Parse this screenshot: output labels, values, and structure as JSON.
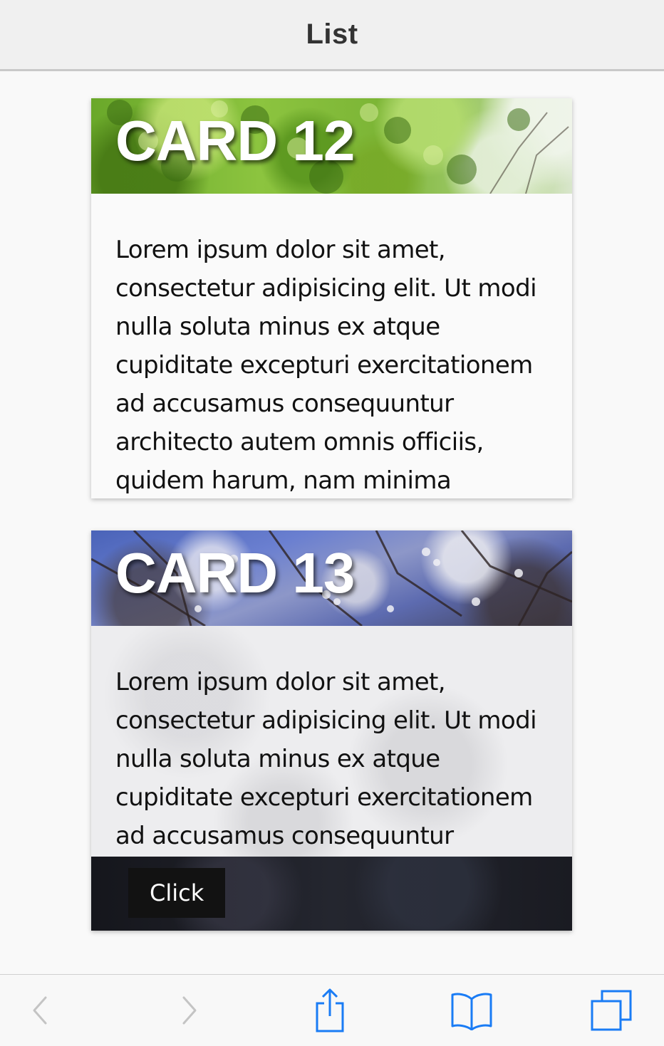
{
  "nav": {
    "title": "List"
  },
  "cards": [
    {
      "title": "CARD 12",
      "body": "Lorem ipsum dolor sit amet, consectetur adipisicing elit. Ut modi nulla soluta minus ex atque cupiditate excepturi exercitationem ad accusamus consequuntur architecto autem omnis officiis, quidem harum, nam minima"
    },
    {
      "title": "CARD 13",
      "body": "Lorem ipsum dolor sit amet, consectetur adipisicing elit. Ut modi nulla soluta minus ex atque cupiditate excepturi exercitationem ad accusamus consequuntur",
      "button_label": "Click"
    }
  ],
  "toolbar": {
    "icons": [
      "back-icon",
      "forward-icon",
      "share-icon",
      "bookmarks-icon",
      "tabs-icon"
    ],
    "accent_color": "#1a7cf5",
    "disabled_color": "#c4c4c4"
  }
}
